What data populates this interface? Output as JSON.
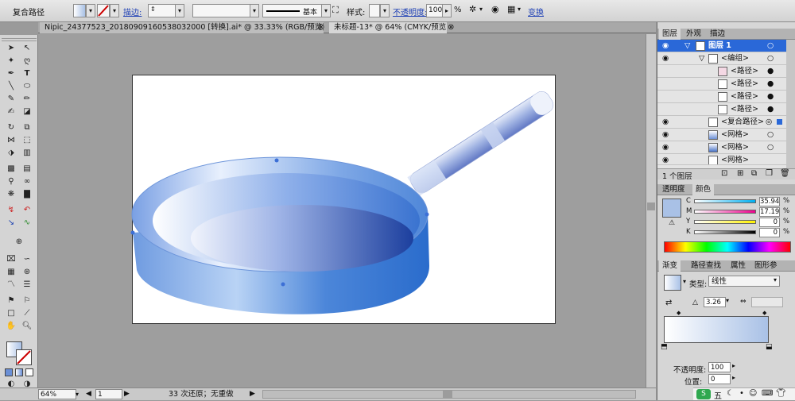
{
  "control_bar": {
    "selection_type": "复合路径",
    "stroke_label": "描边:",
    "stroke_profile": "基本",
    "style_label": "样式:",
    "opacity_label": "不透明度:",
    "opacity_value": "100",
    "opacity_unit": "%",
    "transform_label": "变换"
  },
  "doc_tabs": [
    {
      "label": "Nipic_24377523_20180909160538032000 [转换].ai* @ 33.33% (RGB/预览)",
      "close": "⊗"
    },
    {
      "label": "未标题-13* @ 64% (CMYK/预览)",
      "close": "⊗"
    }
  ],
  "status_bar": {
    "zoom": "64%",
    "page": "1",
    "history": "33 次还原；无重做"
  },
  "layers_panel": {
    "tabs": [
      "图层",
      "外观",
      "描边"
    ],
    "rows": [
      {
        "label": "图层 1",
        "selected": true
      },
      {
        "label": "<编组>"
      },
      {
        "label": "<路径>"
      },
      {
        "label": "<路径>"
      },
      {
        "label": "<路径>"
      },
      {
        "label": "<路径>"
      },
      {
        "label": "<复合路径>"
      },
      {
        "label": "<网格>"
      },
      {
        "label": "<网格>"
      },
      {
        "label": "<网格>"
      }
    ],
    "footer": "1 个图层"
  },
  "color_panel": {
    "tabs": [
      "透明度",
      "颜色"
    ],
    "channels": [
      {
        "name": "C",
        "value": "35.94"
      },
      {
        "name": "M",
        "value": "17.19"
      },
      {
        "name": "Y",
        "value": "0"
      },
      {
        "name": "K",
        "value": "0"
      }
    ],
    "fill_color": "#a9c1e6"
  },
  "gradient_panel": {
    "tabs": [
      "渐变",
      "路径查找",
      "属性",
      "图形参"
    ],
    "type_label": "类型:",
    "type_value": "线性",
    "angle_value": "3.26",
    "opacity_label": "不透明度:",
    "opacity_value": "100",
    "location_label": "位置:",
    "location_value": "0"
  },
  "taskbar": {
    "ime": "五"
  }
}
